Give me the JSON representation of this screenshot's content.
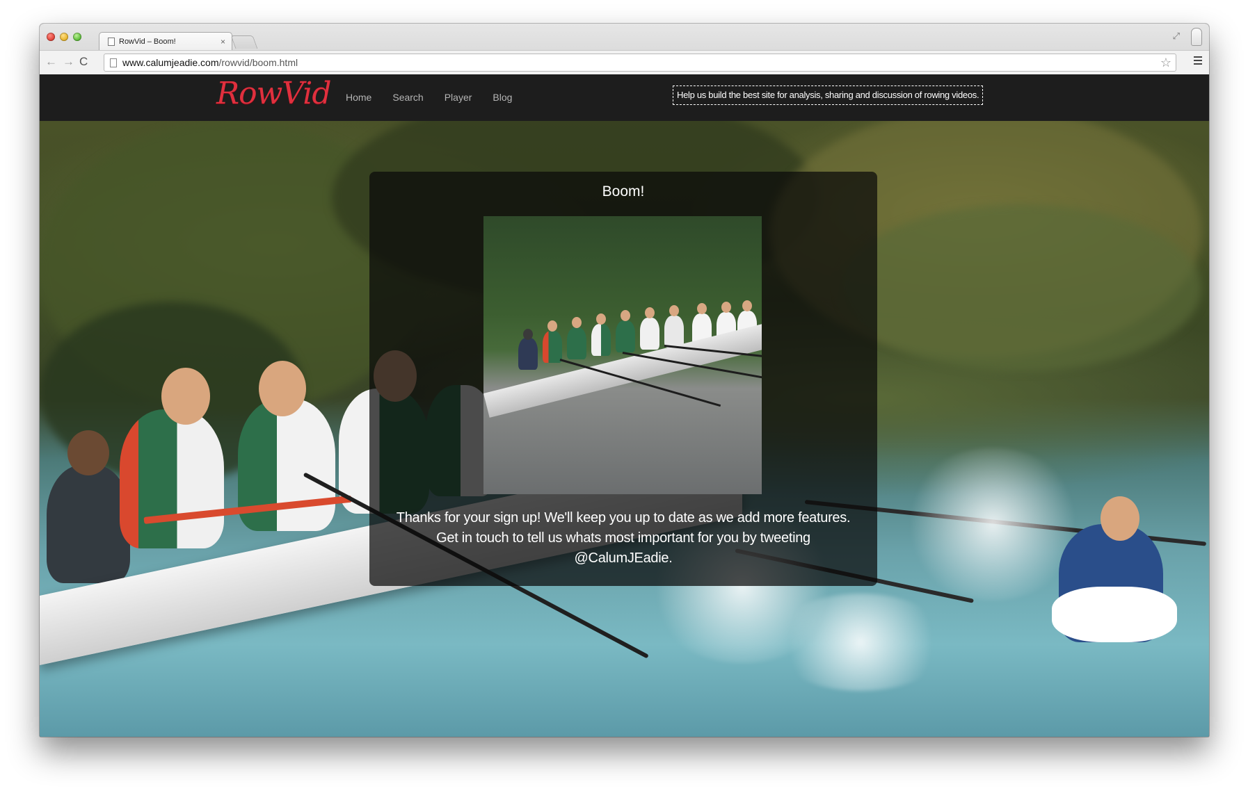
{
  "browser": {
    "tab_title": "RowVid – Boom!",
    "tab_close": "×",
    "url_host": "www.calumjeadie.com",
    "url_path": "/rowvid/boom.html",
    "back_icon": "←",
    "forward_icon": "→",
    "reload_icon": "C",
    "star_icon": "☆",
    "fullscreen_icon": "⤢"
  },
  "site": {
    "logo": "RowVid",
    "nav": [
      {
        "label": "Home"
      },
      {
        "label": "Search"
      },
      {
        "label": "Player"
      },
      {
        "label": "Blog"
      }
    ],
    "promo": "Help us build the best site for analysis, sharing and discussion of rowing videos.",
    "accent_color": "#e0303e"
  },
  "modal": {
    "title": "Boom!",
    "message": "Thanks for your sign up! We'll keep you up to date as we add more features. Get in touch to tell us whats most important for you by tweeting @CalumJEadie."
  }
}
